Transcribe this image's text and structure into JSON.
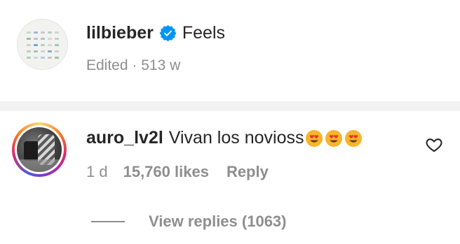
{
  "caption": {
    "username": "lilbieber",
    "text": "Feels",
    "edited_label": "Edited",
    "separator": "·",
    "age": "513 w"
  },
  "comment": {
    "username": "auro_lv2l",
    "text": "Vivan los novioss",
    "emoji": [
      "😍",
      "😍",
      "😍"
    ],
    "age": "1 d",
    "likes": "15,760 likes",
    "reply_label": "Reply",
    "view_replies_label": "View replies (1063)"
  },
  "icons": {
    "verified": "verified-badge-icon",
    "like": "heart-outline-icon"
  },
  "colors": {
    "verified_blue": "#0095f6",
    "text_primary": "#262626",
    "text_secondary": "#8e8e8e",
    "divider": "#f2f2f2"
  }
}
